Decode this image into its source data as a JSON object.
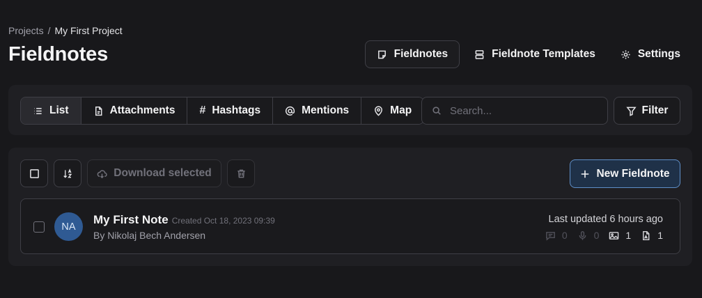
{
  "breadcrumb": {
    "parent": "Projects",
    "separator": "/",
    "current": "My First Project"
  },
  "page": {
    "title": "Fieldnotes"
  },
  "header_nav": [
    {
      "label": "Fieldnotes",
      "icon": "note-icon",
      "active": true
    },
    {
      "label": "Fieldnote Templates",
      "icon": "template-icon",
      "active": false
    },
    {
      "label": "Settings",
      "icon": "gear-icon",
      "active": false
    }
  ],
  "views": [
    {
      "label": "List",
      "icon": "list-icon",
      "active": true
    },
    {
      "label": "Attachments",
      "icon": "file-icon",
      "active": false
    },
    {
      "label": "Hashtags",
      "icon": "hash-icon",
      "active": false
    },
    {
      "label": "Mentions",
      "icon": "at-icon",
      "active": false
    },
    {
      "label": "Map",
      "icon": "map-pin-icon",
      "active": false
    }
  ],
  "search": {
    "placeholder": "Search..."
  },
  "filter": {
    "label": "Filter"
  },
  "actions": {
    "download_label": "Download selected",
    "new_label": "New Fieldnote"
  },
  "notes": [
    {
      "title": "My First Note",
      "created": "Created Oct 18, 2023 09:39",
      "author": "By Nikolaj Bech Andersen",
      "initials": "NA",
      "updated": "Last updated 6 hours ago",
      "stats": {
        "comments": "0",
        "audio": "0",
        "images": "1",
        "files": "1"
      }
    }
  ],
  "colors": {
    "background": "#18181b",
    "panel": "#1f1f23",
    "accent": "#5f8fc8",
    "avatar": "#2f5a93"
  }
}
